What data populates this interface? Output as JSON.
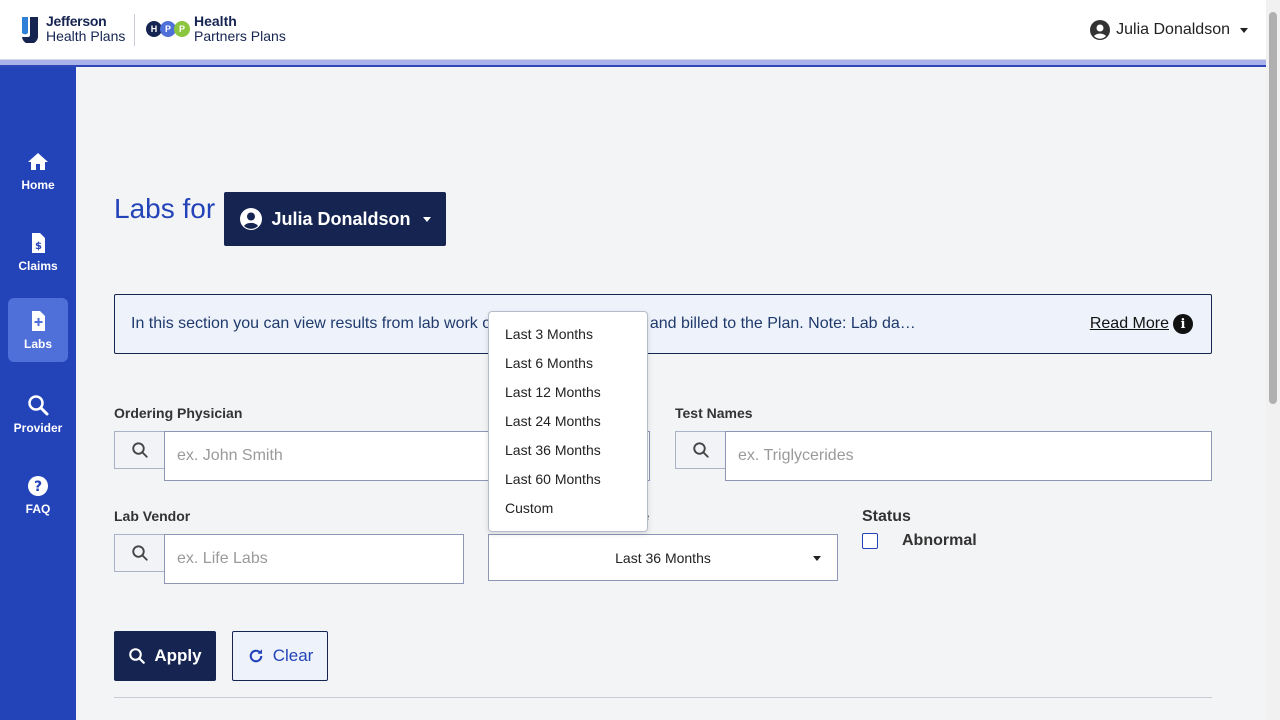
{
  "header": {
    "brand1_line1": "Jefferson",
    "brand1_line2": "Health Plans",
    "brand2_dots": [
      "H",
      "P",
      "P"
    ],
    "brand2_line1": "Health",
    "brand2_line2": "Partners Plans",
    "user_name": "Julia Donaldson"
  },
  "sidebar": {
    "items": [
      {
        "label": "Home",
        "icon": "home-icon"
      },
      {
        "label": "Claims",
        "icon": "claims-icon"
      },
      {
        "label": "Labs",
        "icon": "labs-icon",
        "active": true
      },
      {
        "label": "Provider",
        "icon": "search-icon"
      },
      {
        "label": "FAQ",
        "icon": "question-icon"
      }
    ]
  },
  "page": {
    "heading": "Labs for",
    "member_name": "Julia Donaldson",
    "info_text": "In this section you can view results from lab work o",
    "info_text_tail": "er and billed to the Plan. Note: Lab da…",
    "read_more": "Read More",
    "info_icon_glyph": "i"
  },
  "filters": {
    "ordering_physician_label": "Ordering Physician",
    "ordering_physician_placeholder": "ex. John Smith",
    "test_names_label": "Test Names",
    "test_names_placeholder": "ex. Triglycerides",
    "lab_vendor_label": "Lab Vendor",
    "lab_vendor_placeholder": "ex. Life Labs",
    "date_range_label_visible": "range",
    "date_range_value": "Last 36 Months",
    "status_label": "Status",
    "abnormal_label": "Abnormal",
    "abnormal_checked": false
  },
  "buttons": {
    "apply": "Apply",
    "clear": "Clear"
  },
  "dropdown_options": [
    "Last 3 Months",
    "Last 6 Months",
    "Last 12 Months",
    "Last 24 Months",
    "Last 36 Months",
    "Last 60 Months",
    "Custom"
  ],
  "colors": {
    "sidebar": "#2343b8",
    "primary_dark": "#152451",
    "accent_blue": "#2343b8",
    "hpp_dot1": "#152451",
    "hpp_dot2": "#4f6fd9",
    "hpp_dot3": "#8cc63f"
  }
}
